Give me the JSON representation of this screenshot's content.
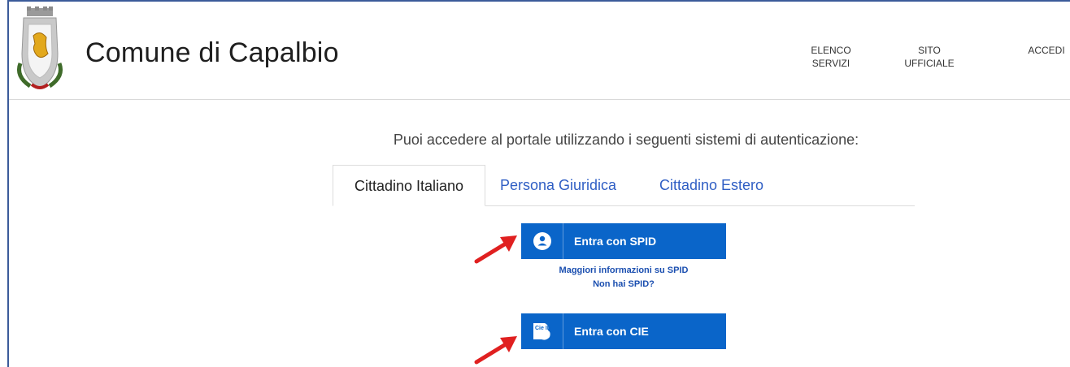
{
  "header": {
    "title": "Comune di Capalbio",
    "crest_icon": "coat-of-arms-icon",
    "nav": {
      "elenco_line1": "ELENCO",
      "elenco_line2": "SERVIZI",
      "sito_line1": "SITO",
      "sito_line2": "UFFICIALE",
      "accedi": "ACCEDI"
    }
  },
  "main": {
    "intro": "Puoi accedere al portale utilizzando i seguenti sistemi di autenticazione:",
    "tabs": [
      {
        "label": "Cittadino Italiano",
        "active": true
      },
      {
        "label": "Persona Giuridica",
        "active": false
      },
      {
        "label": "Cittadino Estero",
        "active": false
      }
    ],
    "spid_button": {
      "label": "Entra con SPID",
      "icon": "spid-user-icon"
    },
    "spid_info_link": "Maggiori informazioni su SPID",
    "no_spid_link": "Non hai SPID?",
    "cie_button": {
      "label": "Entra con CIE",
      "icon": "cie-id-icon",
      "icon_text": "Cie ID"
    }
  },
  "colors": {
    "button_blue": "#0a65c9",
    "link_blue": "#2f5ec4",
    "arrow_red": "#e02020"
  }
}
